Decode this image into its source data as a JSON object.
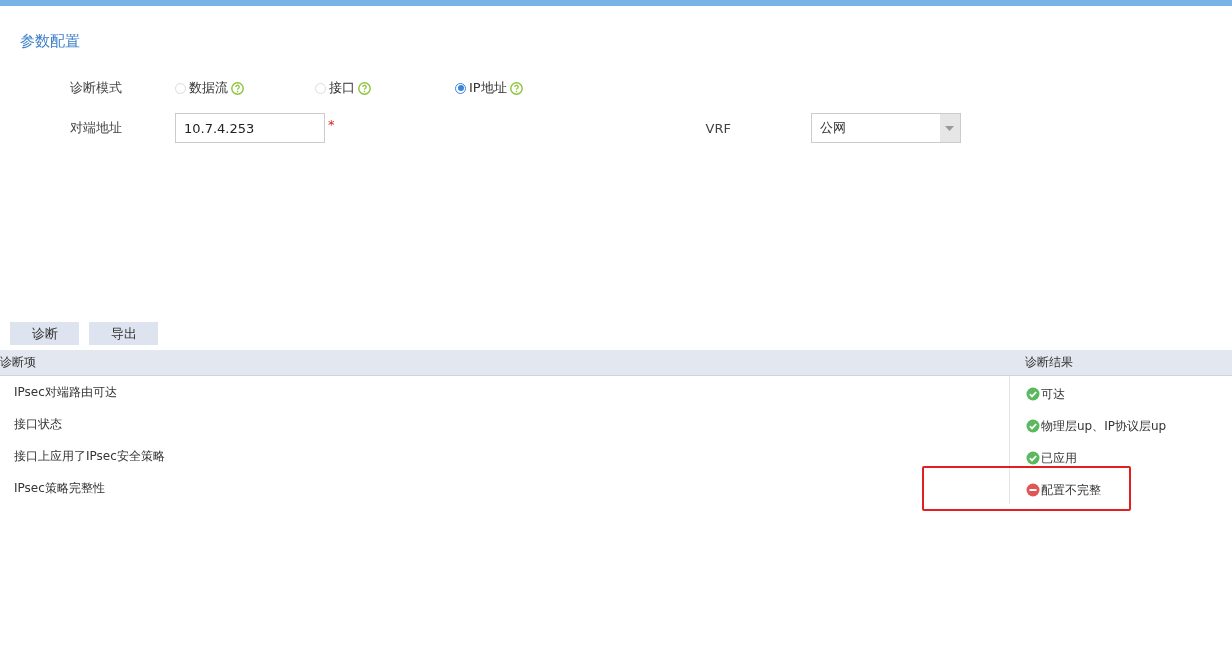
{
  "section_title": "参数配置",
  "diagnosis_mode": {
    "label": "诊断模式",
    "options": [
      {
        "label": "数据流",
        "selected": false
      },
      {
        "label": "接口",
        "selected": false
      },
      {
        "label": "IP地址",
        "selected": true
      }
    ]
  },
  "peer_address": {
    "label": "对端地址",
    "value": "10.7.4.253",
    "required_mark": "*"
  },
  "vrf": {
    "label": "VRF",
    "value": "公网"
  },
  "buttons": [
    "诊断",
    "导出"
  ],
  "table": {
    "columns": [
      "诊断项",
      "诊断结果"
    ],
    "rows": [
      {
        "item": "IPsec对端路由可达",
        "result": "可达",
        "kind": "ok",
        "highlighted": false
      },
      {
        "item": "接口状态",
        "result": "物理层up、IP协议层up",
        "kind": "ok",
        "highlighted": false
      },
      {
        "item": "接口上应用了IPsec安全策略",
        "result": "已应用",
        "kind": "ok",
        "highlighted": false
      },
      {
        "item": "IPsec策略完整性",
        "result": "配置不完整",
        "kind": "error",
        "highlighted": true
      }
    ]
  }
}
